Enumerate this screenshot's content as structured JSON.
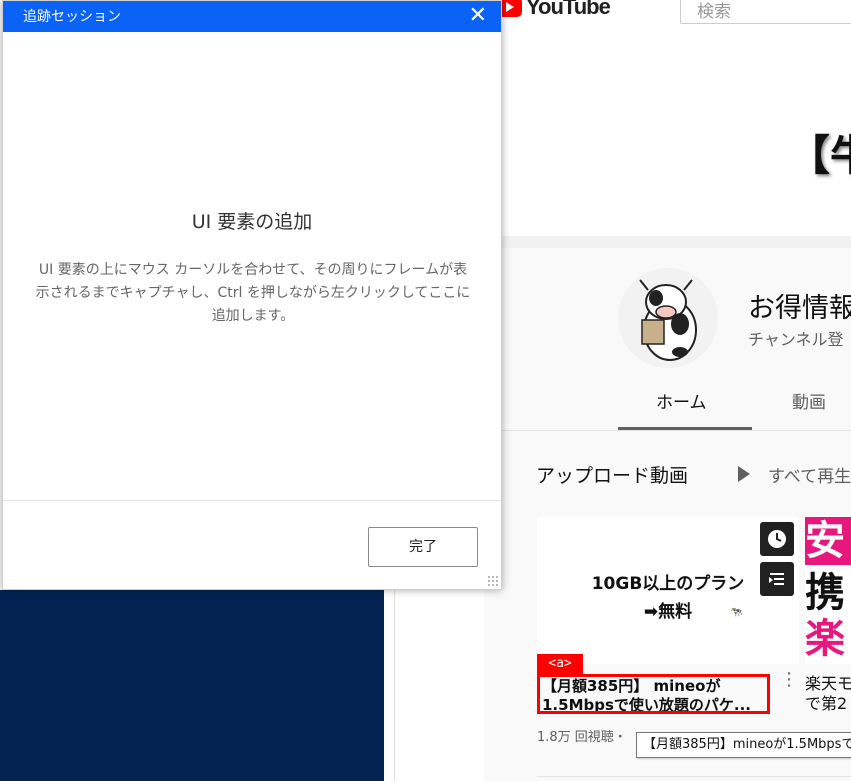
{
  "dialog": {
    "title": "追跡セッション",
    "close_glyph": "✕",
    "heading": "UI 要素の追加",
    "description": "UI 要素の上にマウス カーソルを合わせて、その周りにフレームが表示されるまでキャプチャし、Ctrl を押しながら左クリックしてここに追加します。",
    "done_label": "完了"
  },
  "youtube": {
    "logo_text": "YouTube",
    "search_placeholder": "検索",
    "banner_title": "【牛",
    "channel_name": "お得情報",
    "channel_sub": "チャンネル登",
    "tabs": [
      "ホーム",
      "動画"
    ],
    "section_title": "アップロード動画",
    "play_all": "すべて再生",
    "thumb_line1": "10GB以上のプラン",
    "thumb_line2": "➡無料",
    "thumb2_chars": [
      "安",
      "携",
      "楽"
    ],
    "element_tag": "<a>",
    "video_title_line1": "【月額385円】 mineoが",
    "video_title_line2": "1.5Mbpsで使い放題のパケ...",
    "video2_title_line1": "楽天モ",
    "video2_title_line2": "で第2",
    "views": "1.8万 回視聴・",
    "tooltip": "【月額385円】mineoが1.5Mbpsで"
  },
  "colors": {
    "dialog_title_bar": "#0a63f6",
    "desktop": "#032453",
    "highlight": "#ff0000"
  }
}
